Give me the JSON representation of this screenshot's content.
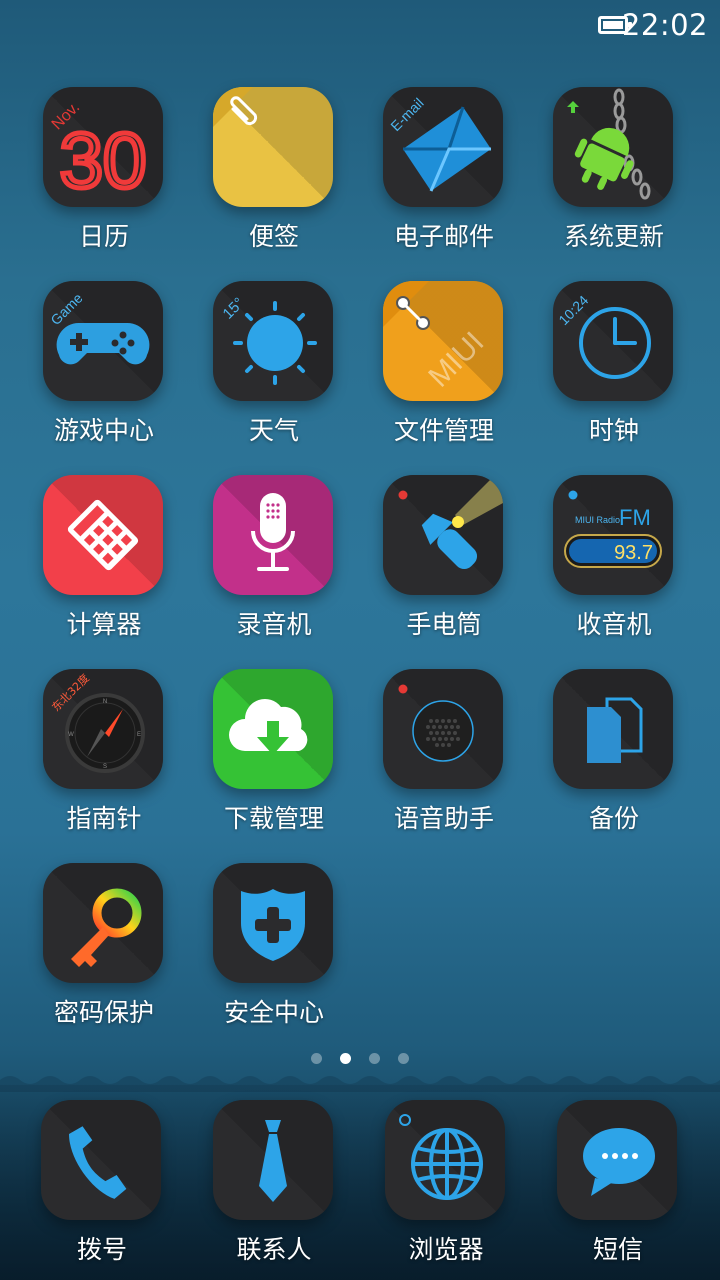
{
  "status_bar": {
    "time": "22:02",
    "battery_level": 1.0
  },
  "apps": [
    {
      "name": "calendar",
      "label": "日历",
      "icon": "calendar-icon",
      "month": "Nov.",
      "day": "30"
    },
    {
      "name": "notes",
      "label": "便签",
      "icon": "notes-icon"
    },
    {
      "name": "email",
      "label": "电子邮件",
      "icon": "email-icon",
      "badge": "E-mail"
    },
    {
      "name": "updater",
      "label": "系统更新",
      "icon": "android-update-icon"
    },
    {
      "name": "game-center",
      "label": "游戏中心",
      "icon": "gamepad-icon",
      "badge": "Game"
    },
    {
      "name": "weather",
      "label": "天气",
      "icon": "sun-icon",
      "badge": "15°"
    },
    {
      "name": "file-manager",
      "label": "文件管理",
      "icon": "folder-icon",
      "watermark": "MIUI"
    },
    {
      "name": "clock",
      "label": "时钟",
      "icon": "clock-icon",
      "badge": "10:24"
    },
    {
      "name": "calculator",
      "label": "计算器",
      "icon": "calculator-icon"
    },
    {
      "name": "recorder",
      "label": "录音机",
      "icon": "microphone-icon"
    },
    {
      "name": "flashlight",
      "label": "手电筒",
      "icon": "flashlight-icon"
    },
    {
      "name": "radio",
      "label": "收音机",
      "icon": "radio-icon",
      "brand": "MIUI Radio",
      "band": "FM",
      "frequency": "93.7"
    },
    {
      "name": "compass",
      "label": "指南针",
      "icon": "compass-icon",
      "badge": "东北32度"
    },
    {
      "name": "downloads",
      "label": "下载管理",
      "icon": "cloud-download-icon"
    },
    {
      "name": "voice-assistant",
      "label": "语音助手",
      "icon": "speaker-icon"
    },
    {
      "name": "backup",
      "label": "备份",
      "icon": "documents-icon"
    },
    {
      "name": "password",
      "label": "密码保护",
      "icon": "key-icon"
    },
    {
      "name": "security",
      "label": "安全中心",
      "icon": "shield-icon"
    }
  ],
  "pager": {
    "count": 4,
    "active_index": 1
  },
  "dock": [
    {
      "name": "dialer",
      "label": "拨号",
      "icon": "phone-icon"
    },
    {
      "name": "contacts",
      "label": "联系人",
      "icon": "tie-icon"
    },
    {
      "name": "browser",
      "label": "浏览器",
      "icon": "globe-icon"
    },
    {
      "name": "messages",
      "label": "短信",
      "icon": "chat-bubble-icon"
    }
  ],
  "colors": {
    "icon_dark": "#2b2b2d",
    "accent_blue": "#2d9fe0",
    "notes_yellow": "#e9c243",
    "files_orange": "#f0a01c",
    "calc_red": "#f2404a",
    "recorder_magenta": "#c2308a",
    "download_green": "#35c235"
  }
}
